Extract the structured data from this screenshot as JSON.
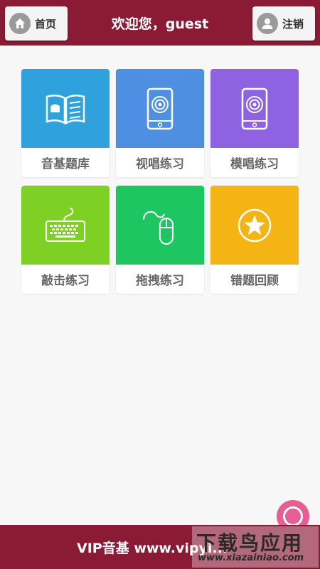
{
  "header": {
    "home_label": "首页",
    "title": "欢迎您，guest",
    "logout_label": "注销",
    "home_icon": "home-icon",
    "logout_icon": "user-icon"
  },
  "tiles": [
    {
      "label": "音基题库",
      "icon": "book-icon",
      "color": "#2fa2dd"
    },
    {
      "label": "视唱练习",
      "icon": "phone-sing-icon",
      "color": "#4f8fe1"
    },
    {
      "label": "模唱练习",
      "icon": "phone-sing-icon",
      "color": "#8f62e2"
    },
    {
      "label": "敲击练习",
      "icon": "keyboard-icon",
      "color": "#7fd024"
    },
    {
      "label": "拖拽练习",
      "icon": "mouse-icon",
      "color": "#1ec662"
    },
    {
      "label": "错题回顾",
      "icon": "star-icon",
      "color": "#f3b414"
    }
  ],
  "footer": {
    "text": "VIP音基 www.vipyi..."
  },
  "watermark": {
    "main": "下载鸟应用",
    "sub": "www.xiazainiao.com"
  },
  "colors": {
    "header_bg": "#8b1a35",
    "fab": "#e75f92"
  }
}
